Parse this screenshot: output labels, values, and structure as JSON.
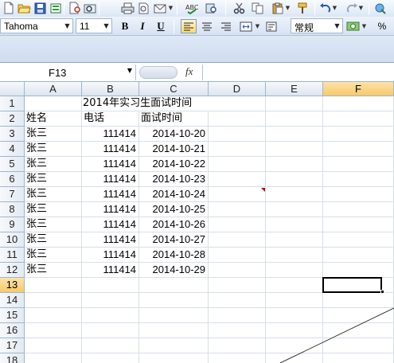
{
  "font": {
    "name": "Tahoma",
    "size": "11"
  },
  "number_format": "常规",
  "format_buttons": {
    "bold": "B",
    "italic": "I",
    "underline": "U"
  },
  "percent_label": "%",
  "name_box": "F13",
  "fx_label": "fx",
  "formula_value": "",
  "columns": [
    "A",
    "B",
    "C",
    "D",
    "E",
    "F"
  ],
  "rows": [
    "1",
    "2",
    "3",
    "4",
    "5",
    "6",
    "7",
    "8",
    "9",
    "10",
    "11",
    "12",
    "13",
    "14",
    "15",
    "16",
    "17",
    "18"
  ],
  "sheet": {
    "title": "2014年实习生面试时间",
    "headers": {
      "name": "姓名",
      "phone": "电话",
      "time": "面试时间"
    },
    "records": [
      {
        "name": "张三",
        "phone": "111414",
        "date": "2014-10-20"
      },
      {
        "name": "张三",
        "phone": "111414",
        "date": "2014-10-21"
      },
      {
        "name": "张三",
        "phone": "111414",
        "date": "2014-10-22"
      },
      {
        "name": "张三",
        "phone": "111414",
        "date": "2014-10-23"
      },
      {
        "name": "张三",
        "phone": "111414",
        "date": "2014-10-24"
      },
      {
        "name": "张三",
        "phone": "111414",
        "date": "2014-10-25"
      },
      {
        "name": "张三",
        "phone": "111414",
        "date": "2014-10-26"
      },
      {
        "name": "张三",
        "phone": "111414",
        "date": "2014-10-27"
      },
      {
        "name": "张三",
        "phone": "111414",
        "date": "2014-10-28"
      },
      {
        "name": "张三",
        "phone": "111414",
        "date": "2014-10-29"
      }
    ]
  },
  "toolbar_icons": [
    "new-file-icon",
    "open-folder-icon",
    "save-icon",
    "permission-icon",
    "print-preview-icon",
    "print-icon",
    "spell-check-icon",
    "research-icon",
    "cut-icon",
    "copy-icon",
    "paste-icon",
    "format-painter-icon",
    "undo-icon",
    "redo-icon"
  ],
  "colors": {
    "selection_header": "#f8c96b",
    "grid_line": "#d6dfe9",
    "header_border": "#9eb6ce",
    "comment_indicator": "#c00000"
  }
}
